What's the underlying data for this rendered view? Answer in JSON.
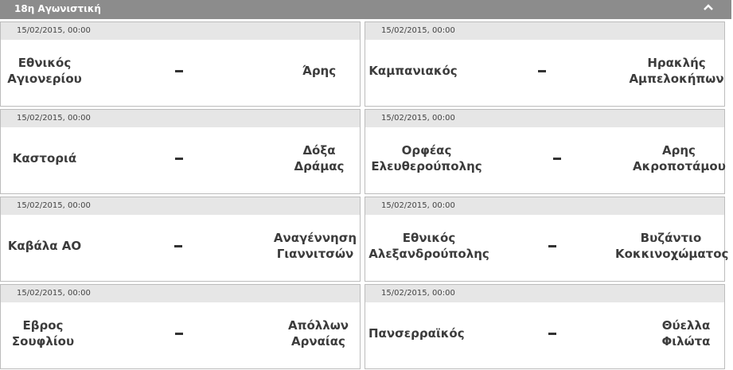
{
  "header": {
    "title": "18η Αγωνιστική",
    "collapse_icon": "chevron-up-icon"
  },
  "matches": [
    {
      "date": "15/02/2015, 00:00",
      "home": [
        "Εθνικός",
        "Αγιονερίου"
      ],
      "away": [
        "Άρης"
      ]
    },
    {
      "date": "15/02/2015, 00:00",
      "home": [
        "Καμπανιακός"
      ],
      "away": [
        "Ηρακλής",
        "Αμπελοκήπων"
      ]
    },
    {
      "date": "15/02/2015, 00:00",
      "home": [
        "Καστοριά"
      ],
      "away": [
        "Δόξα",
        "Δράμας"
      ]
    },
    {
      "date": "15/02/2015, 00:00",
      "home": [
        "Ορφέας",
        "Ελευθερούπολης"
      ],
      "away": [
        "Αρης",
        "Ακροποτάμου"
      ]
    },
    {
      "date": "15/02/2015, 00:00",
      "home": [
        "Καβάλα ΑΟ"
      ],
      "away": [
        "Αναγέννηση",
        "Γιαννιτσών"
      ]
    },
    {
      "date": "15/02/2015, 00:00",
      "home": [
        "Εθνικός",
        "Αλεξανδρούπολης"
      ],
      "away": [
        "Βυζάντιο",
        "Κοκκινοχώματος"
      ]
    },
    {
      "date": "15/02/2015, 00:00",
      "home": [
        "Εβρος",
        "Σουφλίου"
      ],
      "away": [
        "Απόλλων",
        "Αρναίας"
      ]
    },
    {
      "date": "15/02/2015, 00:00",
      "home": [
        "Πανσερραϊκός"
      ],
      "away": [
        "Θύελλα",
        "Φιλώτα"
      ]
    }
  ]
}
